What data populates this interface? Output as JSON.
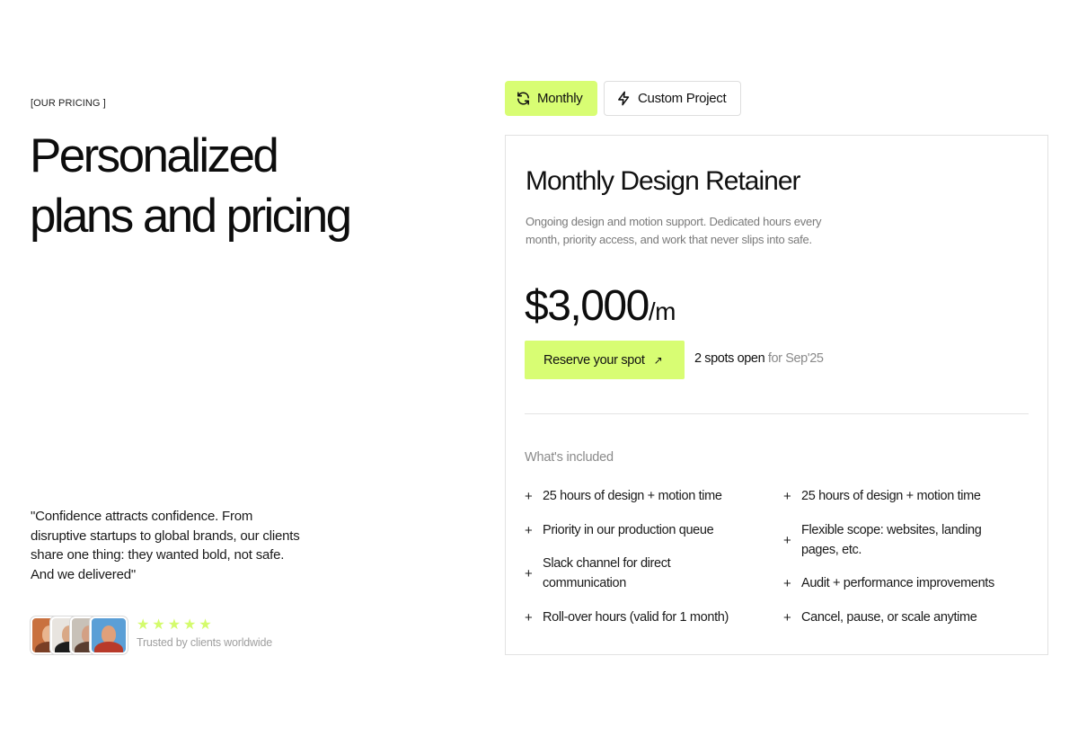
{
  "left": {
    "eyebrow": "[OUR PRICING ]",
    "headline_line1": "Personalized",
    "headline_line2": "plans and pricing",
    "quote": "\"Confidence attracts confidence. From disruptive startups to global brands, our clients share one thing: they wanted bold, not safe. And we delivered\"",
    "rating_stars": 5,
    "trust_text": "Trusted by clients worldwide"
  },
  "tabs": [
    {
      "label": "Monthly",
      "icon": "refresh-icon",
      "active": true
    },
    {
      "label": "Custom Project",
      "icon": "lightning-icon",
      "active": false
    }
  ],
  "plan": {
    "title": "Monthly Design Retainer",
    "description": "Ongoing design and motion support. Dedicated hours every month, priority access, and work that never slips into safe.",
    "price": "$3,000",
    "price_period": "/m",
    "cta_label": "Reserve your spot",
    "cta_icon": "arrow-up-right-icon",
    "spots_count": "2 spots open",
    "spots_period": "for Sep'25",
    "included_label": "What's included",
    "features_left": [
      "25 hours of design + motion time",
      "Priority in our production queue",
      "Slack channel for direct communication",
      "Roll-over hours (valid for 1 month)"
    ],
    "features_right": [
      "25 hours of design + motion time",
      "Flexible scope: websites, landing pages, etc.",
      "Audit + performance improvements",
      "Cancel, pause, or scale anytime"
    ]
  },
  "colors": {
    "accent": "#d8fd73",
    "star": "#d4fb6c",
    "muted_text": "#8a8a8a",
    "border": "#e2e2e2"
  }
}
